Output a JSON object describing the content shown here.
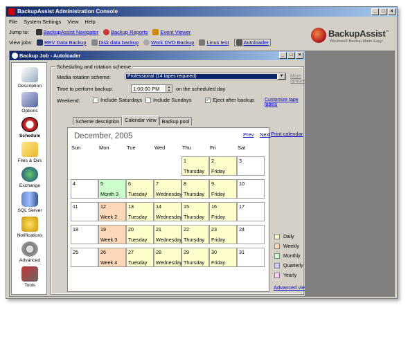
{
  "window": {
    "title": "BackupAssist Administration Console"
  },
  "menu": [
    "File",
    "System Settings",
    "View",
    "Help"
  ],
  "jumpto": {
    "label": "Jump to:",
    "items": [
      "BackupAssist Navigator",
      "Backup Reports",
      "Event Viewer"
    ]
  },
  "viewjobs": {
    "label": "View jobs:",
    "items": [
      "REV Data Backup",
      "Disk data backup",
      "Work DVD Backup",
      "Linus test",
      "Autoloader"
    ]
  },
  "logo": {
    "name": "BackupAssist",
    "tm": "™",
    "tagline": "Windows® Backup Made Easy!"
  },
  "subwin": {
    "title": "Backup Job - Autoloader"
  },
  "sidebar": [
    "Description",
    "Options",
    "Schedule",
    "Files & Dirs",
    "Exchange",
    "SQL Server",
    "Notifications",
    "Advanced",
    "Tools"
  ],
  "group": {
    "title": "Scheduling and rotation scheme"
  },
  "rotation": {
    "label": "Media rotation scheme:",
    "value": "Professional (14 tapes required)",
    "more": "More options..."
  },
  "time": {
    "label": "Time to perform backup:",
    "value": "1:00:00 PM",
    "suffix": "on the scheduled day"
  },
  "weekend": {
    "label": "Weekend:",
    "sat": "Include Saturdays",
    "sun": "Include Sundays",
    "eject": "Eject after backup",
    "customize": "Customize tape labels"
  },
  "tabs": [
    "Scheme description",
    "Calendar view",
    "Backup pool"
  ],
  "calendar": {
    "title": "December, 2005",
    "prev": "Prev",
    "next": "Next",
    "print": "Print calendar",
    "days": [
      "Sun",
      "Mon",
      "Tue",
      "Wed",
      "Thu",
      "Fri",
      "Sat"
    ]
  },
  "cal_rows": [
    [
      {
        "d": "",
        "l": ""
      },
      {
        "d": "",
        "l": ""
      },
      {
        "d": "",
        "l": ""
      },
      {
        "d": "",
        "l": ""
      },
      {
        "d": "1",
        "l": "Thursday"
      },
      {
        "d": "2",
        "l": "Friday"
      },
      {
        "d": "3",
        "l": ""
      }
    ],
    [
      {
        "d": "4",
        "l": ""
      },
      {
        "d": "5",
        "l": "Month 3"
      },
      {
        "d": "6",
        "l": "Tuesday"
      },
      {
        "d": "7",
        "l": "Wednesday"
      },
      {
        "d": "8",
        "l": "Thursday"
      },
      {
        "d": "9",
        "l": "Friday"
      },
      {
        "d": "10",
        "l": ""
      }
    ],
    [
      {
        "d": "11",
        "l": ""
      },
      {
        "d": "12",
        "l": "Week 2"
      },
      {
        "d": "13",
        "l": "Tuesday"
      },
      {
        "d": "14",
        "l": "Wednesday"
      },
      {
        "d": "15",
        "l": "Thursday"
      },
      {
        "d": "16",
        "l": "Friday"
      },
      {
        "d": "17",
        "l": ""
      }
    ],
    [
      {
        "d": "18",
        "l": ""
      },
      {
        "d": "19",
        "l": "Week 3"
      },
      {
        "d": "20",
        "l": "Tuesday"
      },
      {
        "d": "21",
        "l": "Wednesday"
      },
      {
        "d": "22",
        "l": "Thursday"
      },
      {
        "d": "23",
        "l": "Friday"
      },
      {
        "d": "24",
        "l": ""
      }
    ],
    [
      {
        "d": "25",
        "l": ""
      },
      {
        "d": "26",
        "l": "Week 4"
      },
      {
        "d": "27",
        "l": "Tuesday"
      },
      {
        "d": "28",
        "l": "Wednesday"
      },
      {
        "d": "29",
        "l": "Thursday"
      },
      {
        "d": "30",
        "l": "Friday"
      },
      {
        "d": "31",
        "l": ""
      }
    ]
  ],
  "legend": [
    {
      "label": "Daily",
      "color": "#ffffcc"
    },
    {
      "label": "Weekly",
      "color": "#ffd8b8"
    },
    {
      "label": "Monthly",
      "color": "#ccffcc"
    },
    {
      "label": "Quarterly",
      "color": "#ccccff"
    },
    {
      "label": "Yearly",
      "color": "#ffccff"
    }
  ],
  "advanced_view": "Advanced view"
}
